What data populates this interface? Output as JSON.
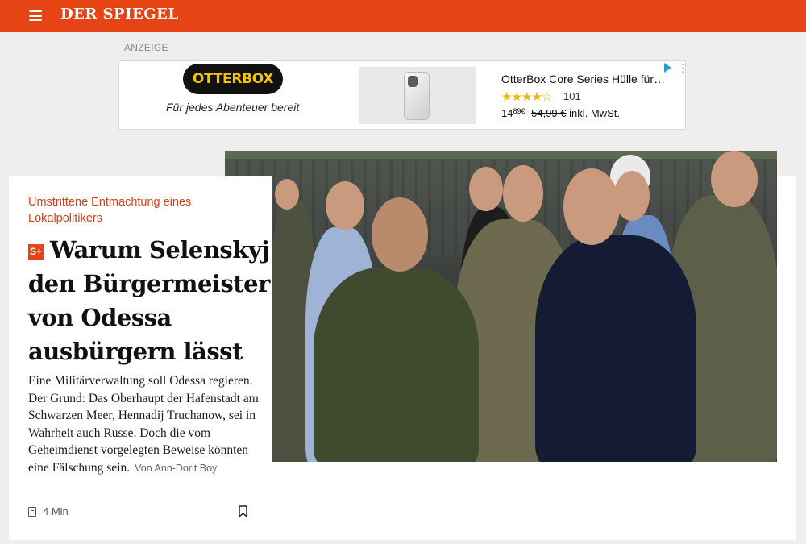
{
  "header": {
    "logo_text": "DER SPIEGEL",
    "menu_icon": "hamburger-menu-icon",
    "brand_color": "#e64415"
  },
  "ad": {
    "label": "ANZEIGE",
    "brand": "OTTERBOX",
    "tagline": "Für jedes Abenteuer bereit",
    "product_title": "OtterBox Core Series Hülle für…",
    "stars": "★★★★☆",
    "rating_count": "101",
    "price_main": "14",
    "price_cents": "89€",
    "price_old": "54,99 €",
    "price_suffix": "inkl. MwSt.",
    "choice_icon": "adchoices-icon",
    "more_icon": "more-vertical-icon"
  },
  "article": {
    "kicker": "Umstrittene Entmachtung eines Lokalpolitikers",
    "badge": "S+",
    "headline": "Warum Selenskyj den Bürgermeister von Odessa ausbürgern lässt",
    "teaser": "Eine Militärverwaltung soll Odessa regieren. Der Grund: Das Oberhaupt der Hafenstadt am Schwarzen Meer, Hennadij Truchanow, sei in Wahrheit auch Russe. Doch die vom Geheimdienst vorgelegten Beweise könnten eine Fälschung sein.",
    "byline": "Von Ann-Dorit Boy",
    "read_time": "4 Min",
    "accent_color": "#d0441a"
  }
}
